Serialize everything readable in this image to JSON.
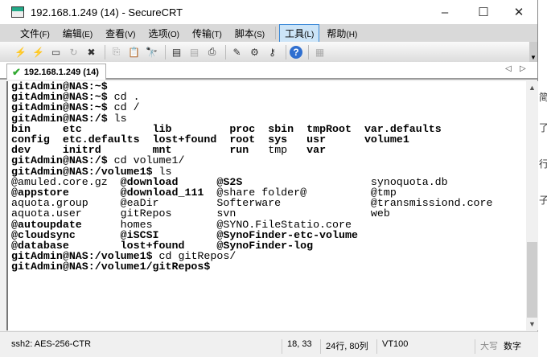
{
  "window": {
    "title": "192.168.1.249 (14) - SecureCRT",
    "minimize": "–",
    "maximize": "☐",
    "close": "✕"
  },
  "menu": [
    {
      "label": "文件",
      "key": "(F)"
    },
    {
      "label": "编辑",
      "key": "(E)"
    },
    {
      "label": "查看",
      "key": "(V)"
    },
    {
      "label": "选项",
      "key": "(O)"
    },
    {
      "label": "传输",
      "key": "(T)"
    },
    {
      "label": "脚本",
      "key": "(S)"
    },
    {
      "label": "工具",
      "key": "(L)"
    },
    {
      "label": "帮助",
      "key": "(H)"
    }
  ],
  "toolbar": [
    {
      "icon": "quick-connect-icon",
      "g": "⚡"
    },
    {
      "icon": "connect-in-tab-icon",
      "g": "⚡"
    },
    {
      "icon": "connect-icon",
      "g": "▭"
    },
    {
      "icon": "reconnect-icon",
      "g": "↻",
      "disabled": true
    },
    {
      "icon": "disconnect-icon",
      "g": "✖"
    },
    {
      "sep": true
    },
    {
      "icon": "copy-icon",
      "g": "⎘",
      "disabled": true
    },
    {
      "icon": "paste-icon",
      "g": "📋",
      "disabled": true
    },
    {
      "icon": "find-icon",
      "g": "🔭"
    },
    {
      "sep": true
    },
    {
      "icon": "print-screen-icon",
      "g": "▤"
    },
    {
      "icon": "print-selection-icon",
      "g": "▤",
      "disabled": true
    },
    {
      "icon": "print-icon",
      "g": "⎙"
    },
    {
      "sep": true
    },
    {
      "icon": "session-options-icon",
      "g": "✎"
    },
    {
      "icon": "global-options-icon",
      "g": "⚙"
    },
    {
      "icon": "keymap-icon",
      "g": "⚷"
    },
    {
      "sep": true
    },
    {
      "icon": "help-icon",
      "g": "?"
    },
    {
      "sep": true
    },
    {
      "icon": "sftp-icon",
      "g": "▦",
      "disabled": true
    }
  ],
  "tab": {
    "label": "192.168.1.249 (14)"
  },
  "terminal": {
    "lines": [
      [
        {
          "t": "gitAdmin@NAS:~$",
          "b": 1
        }
      ],
      [
        {
          "t": "gitAdmin@NAS:~$",
          "b": 1
        },
        {
          "t": " cd ."
        }
      ],
      [
        {
          "t": "gitAdmin@NAS:~$",
          "b": 1
        },
        {
          "t": " cd /"
        }
      ],
      [
        {
          "t": "gitAdmin@NAS:/$",
          "b": 1
        },
        {
          "t": " ls"
        }
      ],
      [
        {
          "t": "bin     ",
          "b": 1
        },
        {
          "t": "etc           ",
          "b": 1
        },
        {
          "t": "lib         ",
          "b": 1
        },
        {
          "t": "proc  ",
          "b": 1
        },
        {
          "t": "sbin  ",
          "b": 1
        },
        {
          "t": "tmpRoot  ",
          "b": 1
        },
        {
          "t": "var.defaults",
          "b": 1
        }
      ],
      [
        {
          "t": "config  ",
          "b": 1
        },
        {
          "t": "etc.defaults  ",
          "b": 1
        },
        {
          "t": "lost+found  ",
          "b": 1
        },
        {
          "t": "root  ",
          "b": 1
        },
        {
          "t": "sys   ",
          "b": 1
        },
        {
          "t": "usr      ",
          "b": 1
        },
        {
          "t": "volume1",
          "b": 1
        }
      ],
      [
        {
          "t": "dev     ",
          "b": 1
        },
        {
          "t": "initrd        ",
          "b": 1
        },
        {
          "t": "mnt         ",
          "b": 1
        },
        {
          "t": "run   ",
          "b": 1
        },
        {
          "t": "tmp   "
        },
        {
          "t": "var",
          "b": 1
        }
      ],
      [
        {
          "t": "gitAdmin@NAS:/$",
          "b": 1
        },
        {
          "t": " cd volume1/"
        }
      ],
      [
        {
          "t": "gitAdmin@NAS:/volume1$",
          "b": 1
        },
        {
          "t": " ls"
        }
      ],
      [
        {
          "t": "@amuled.core.gz  "
        },
        {
          "t": "@download",
          "b": 1
        },
        {
          "t": "      "
        },
        {
          "t": "@S2S",
          "b": 1
        },
        {
          "t": "                    "
        },
        {
          "t": "synoquota.db"
        }
      ],
      [
        {
          "t": "@appstore",
          "b": 1
        },
        {
          "t": "        "
        },
        {
          "t": "@download_111",
          "b": 1
        },
        {
          "t": "  "
        },
        {
          "t": "@share folder@          "
        },
        {
          "t": "@tmp"
        }
      ],
      [
        {
          "t": "aquota.group     "
        },
        {
          "t": "@eaDir         "
        },
        {
          "t": "Softerware              "
        },
        {
          "t": "@transmissiond.core"
        }
      ],
      [
        {
          "t": "aquota.user      "
        },
        {
          "t": "gitRepos       "
        },
        {
          "t": "svn                     "
        },
        {
          "t": "web"
        }
      ],
      [
        {
          "t": "@autoupdate",
          "b": 1
        },
        {
          "t": "      "
        },
        {
          "t": "homes          "
        },
        {
          "t": "@SYNO.FileStatio.core"
        }
      ],
      [
        {
          "t": "@cloudsync",
          "b": 1
        },
        {
          "t": "       "
        },
        {
          "t": "@iSCSI",
          "b": 1
        },
        {
          "t": "         "
        },
        {
          "t": "@SynoFinder-etc-volume",
          "b": 1
        }
      ],
      [
        {
          "t": "@database",
          "b": 1
        },
        {
          "t": "        "
        },
        {
          "t": "lost+found",
          "b": 1
        },
        {
          "t": "     "
        },
        {
          "t": "@SynoFinder-log",
          "b": 1
        }
      ],
      [
        {
          "t": "gitAdmin@NAS:/volume1$",
          "b": 1
        },
        {
          "t": " cd gitRepos/"
        }
      ],
      [
        {
          "t": "gitAdmin@NAS:/volume1/gitRepos$",
          "b": 1
        }
      ]
    ]
  },
  "status": {
    "cipher": "ssh2: AES-256-CTR",
    "cursor": "18,  33",
    "size": "24行, 80列",
    "emulation": "VT100",
    "caps": "大写",
    "num": "数字"
  },
  "background": {
    "chars": [
      "简",
      "了",
      "行",
      "子"
    ]
  }
}
